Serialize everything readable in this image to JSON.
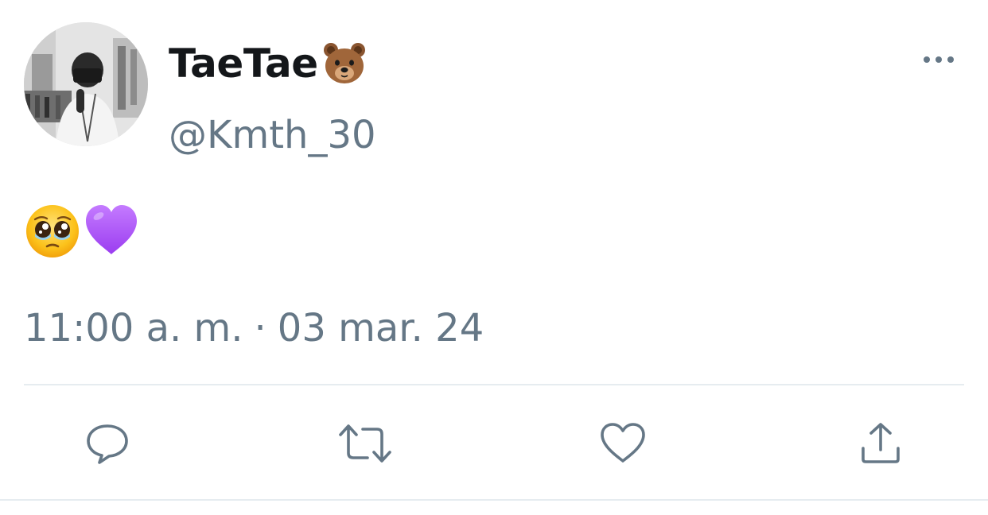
{
  "user": {
    "display_name": "TaeTae",
    "name_badge_icon": "bear-face-icon",
    "handle": "@Kmth_30",
    "avatar": "grayscale mirror-selfie photo"
  },
  "tweet": {
    "content_icons": [
      "pleading-face-icon",
      "purple-heart-icon"
    ],
    "time": "11:00 a. m.",
    "separator": "·",
    "date": "03 mar. 24"
  },
  "header": {
    "more_icon": "more-dots-icon"
  },
  "actions": [
    {
      "name": "reply",
      "icon": "reply-icon"
    },
    {
      "name": "retweet",
      "icon": "retweet-icon"
    },
    {
      "name": "like",
      "icon": "heart-outline-icon"
    },
    {
      "name": "share",
      "icon": "share-icon"
    }
  ],
  "colors": {
    "text_primary": "#14171a",
    "text_secondary": "#657786",
    "divider": "#e6ecf0",
    "icon": "#657786",
    "purple_heart": "#a855f7",
    "bear": "#a0663a",
    "face_yellow": "#fcc21b"
  }
}
